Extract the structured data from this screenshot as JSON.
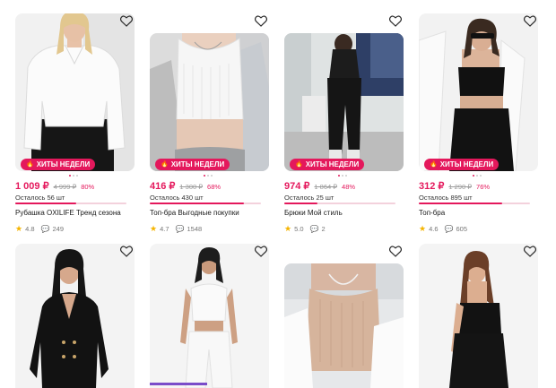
{
  "badge_label": "ХИТЫ НЕДЕЛИ",
  "colors": {
    "accent": "#e4185c",
    "star": "#f5b400"
  },
  "products": [
    {
      "price": "1 009 ₽",
      "old_price": "4 999 ₽",
      "discount": "80%",
      "stock": "Осталось 56 шт",
      "stock_fill": 0.55,
      "title": "Рубашка OXILIFE Тренд сезона",
      "rating": "4.8",
      "reviews": "249"
    },
    {
      "price": "416 ₽",
      "old_price": "1 300 ₽",
      "discount": "68%",
      "stock": "Осталось 430 шт",
      "stock_fill": 0.85,
      "title": "Топ-бра Выгодные покупки",
      "rating": "4.7",
      "reviews": "1548"
    },
    {
      "price": "974 ₽",
      "old_price": "1 864 ₽",
      "discount": "48%",
      "stock": "Осталось 25 шт",
      "stock_fill": 0.3,
      "title": "Брюки Мой стиль",
      "rating": "5.0",
      "reviews": "2"
    },
    {
      "price": "312 ₽",
      "old_price": "1 290 ₽",
      "discount": "76%",
      "stock": "Осталось 895 шт",
      "stock_fill": 0.75,
      "title": "Топ-бра",
      "rating": "4.6",
      "reviews": "605"
    }
  ]
}
